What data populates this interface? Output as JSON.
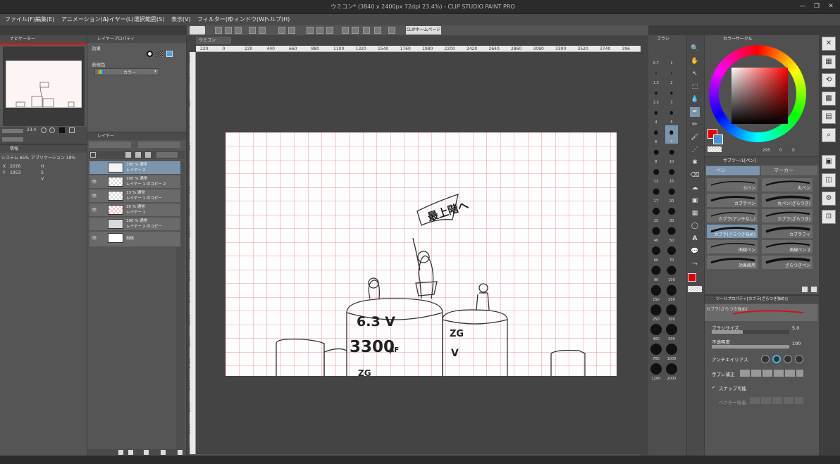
{
  "window": {
    "title": "ウミコン* (3840 x 2400px 72dpi 23.4%)  - CLIP STUDIO PAINT PRO",
    "buttons": [
      "—",
      "❐",
      "✕"
    ]
  },
  "menu": [
    "ファイル(F)",
    "編集(E)",
    "アニメーション(A)",
    "レイヤー(L)",
    "選択範囲(S)",
    "表示(V)",
    "フィルター(I)",
    "ウィンドウ(W)",
    "ヘルプ(H)"
  ],
  "toolbar": {
    "home_label": "CLIPホームページ"
  },
  "canvas_tab": "ウミコン",
  "ruler": {
    "top": [
      "220",
      "0",
      "220",
      "440",
      "660",
      "880",
      "1100",
      "1320",
      "1540",
      "1760",
      "1980",
      "2200",
      "2420",
      "2640",
      "2860",
      "3080",
      "3300",
      "3520",
      "3740",
      "396"
    ],
    "left": [
      "660",
      "440",
      "220",
      "0",
      "220",
      "440",
      "660",
      "880",
      "1100",
      "1320",
      "1540",
      "1760",
      "1980",
      "2200",
      "2420",
      "2640",
      "2860",
      "3080",
      "3300"
    ]
  },
  "navigator": {
    "tab": "ナビゲーター",
    "zoom": "23.4"
  },
  "info": {
    "tab": "情報",
    "system": "システム 65%",
    "app": "アプリケーション 18%",
    "x_label": "X",
    "x_value": "2076",
    "y_label": "Y",
    "y_value": "1953",
    "h_label": "H",
    "s_label": "S",
    "v_label": "V"
  },
  "layer_property": {
    "tab": "レイヤープロパティ",
    "effect_label": "効果",
    "color_label": "表現色",
    "color_value": "カラー"
  },
  "layers": {
    "tab": "レイヤー",
    "rows": [
      {
        "line1": "100 % 通常",
        "line2": "レイヤー 2",
        "selected": true,
        "visible": false,
        "thumb": "white"
      },
      {
        "line1": "100 % 通常",
        "line2": "レイヤー 1 のコピー 2",
        "selected": false,
        "visible": true,
        "thumb": "check"
      },
      {
        "line1": "13 % 通常",
        "line2": "レイヤー 1 のコピー",
        "selected": false,
        "visible": true,
        "thumb": "check"
      },
      {
        "line1": "35 % 通常",
        "line2": "レイヤー 1",
        "selected": false,
        "visible": true,
        "thumb": "red"
      },
      {
        "line1": "100 % 通常",
        "line2": "レイヤー 2 のコピー",
        "selected": false,
        "visible": false,
        "thumb": "dark"
      },
      {
        "line1": "",
        "line2": "用紙",
        "selected": false,
        "visible": true,
        "thumb": "white"
      }
    ]
  },
  "brush_sizes": {
    "tab": "ブラシ",
    "col1": [
      "0.7",
      "1.5",
      "2.5",
      "4",
      "6",
      "8",
      "12",
      "17",
      "25",
      "40",
      "60",
      "90",
      "150",
      "250",
      "400",
      "700",
      "1200"
    ],
    "col2": [
      "1",
      "2",
      "3",
      "5",
      "7",
      "10",
      "15",
      "20",
      "30",
      "50",
      "70",
      "100",
      "200",
      "300",
      "500",
      "1000",
      "2000"
    ]
  },
  "color_circle": {
    "tab": "カラーサークル",
    "current": "#e00000",
    "h": "295",
    "s": "0",
    "v": "0"
  },
  "subtool": {
    "tab": "サブツール[ペン]",
    "groups": [
      "ペン",
      "マーカー"
    ],
    "items": [
      "Gペン",
      "丸ペン",
      "カブラペン",
      "丸ペン(ざらつき)",
      "カブラ(アンチなし)",
      "カブラ(ざらつき)",
      "カブラ(ざらつき強め)",
      "カブラフィ",
      "曲線ペン",
      "曲線ペン 2",
      "効果線用",
      "ざらつきペン"
    ]
  },
  "tool_property": {
    "tab": "ツールプロパティ[カブラ(ざらつき強め)]",
    "name": "カブラ(ざらつき強め)",
    "brush_size_label": "ブラシサイズ",
    "brush_size_value": "5.0",
    "opacity_label": "不透明度",
    "opacity_value": "100",
    "antialias_label": "アンチエイリアス",
    "stabilization_label": "手ブレ補正",
    "snap_label": "スナップ可能",
    "vector_label": "ベクター吸着"
  },
  "artwork": {
    "flag_text": "最上階へ",
    "label_1": "6.3 V",
    "label_2": "3300",
    "label_2_unit": "μF",
    "label_3": "ZG",
    "label_4": "V",
    "label_5": "ZG"
  },
  "colors": {
    "bg": "#3c3c3c",
    "panel": "#5a5a5a",
    "selection": "#7c95ad",
    "grid": "#e46070",
    "accent_red": "#e00000"
  }
}
